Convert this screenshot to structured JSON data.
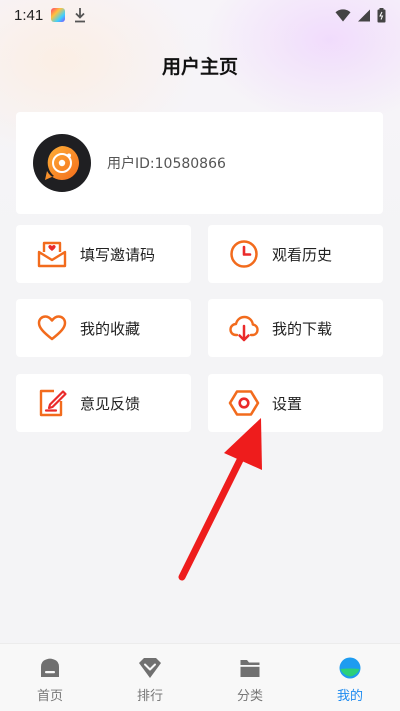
{
  "status_bar": {
    "time": "1:41"
  },
  "header": {
    "title": "用户主页"
  },
  "profile": {
    "user_id": "用户ID:10580866"
  },
  "menu": [
    {
      "label": "填写邀请码",
      "icon": "invite-envelope-icon"
    },
    {
      "label": "观看历史",
      "icon": "clock-icon"
    },
    {
      "label": "我的收藏",
      "icon": "heart-icon"
    },
    {
      "label": "我的下载",
      "icon": "cloud-download-icon"
    },
    {
      "label": "意见反馈",
      "icon": "feedback-edit-icon"
    },
    {
      "label": "设置",
      "icon": "settings-hexagon-icon"
    }
  ],
  "bottom_nav": [
    {
      "label": "首页",
      "icon": "home-icon",
      "active": false
    },
    {
      "label": "排行",
      "icon": "ranking-diamond-icon",
      "active": false
    },
    {
      "label": "分类",
      "icon": "category-folder-icon",
      "active": false
    },
    {
      "label": "我的",
      "icon": "profile-icon",
      "active": true
    }
  ],
  "colors": {
    "accent_orange": "#f26b1d",
    "accent_red": "#ea2a2a",
    "active_blue": "#1d8bf0"
  }
}
